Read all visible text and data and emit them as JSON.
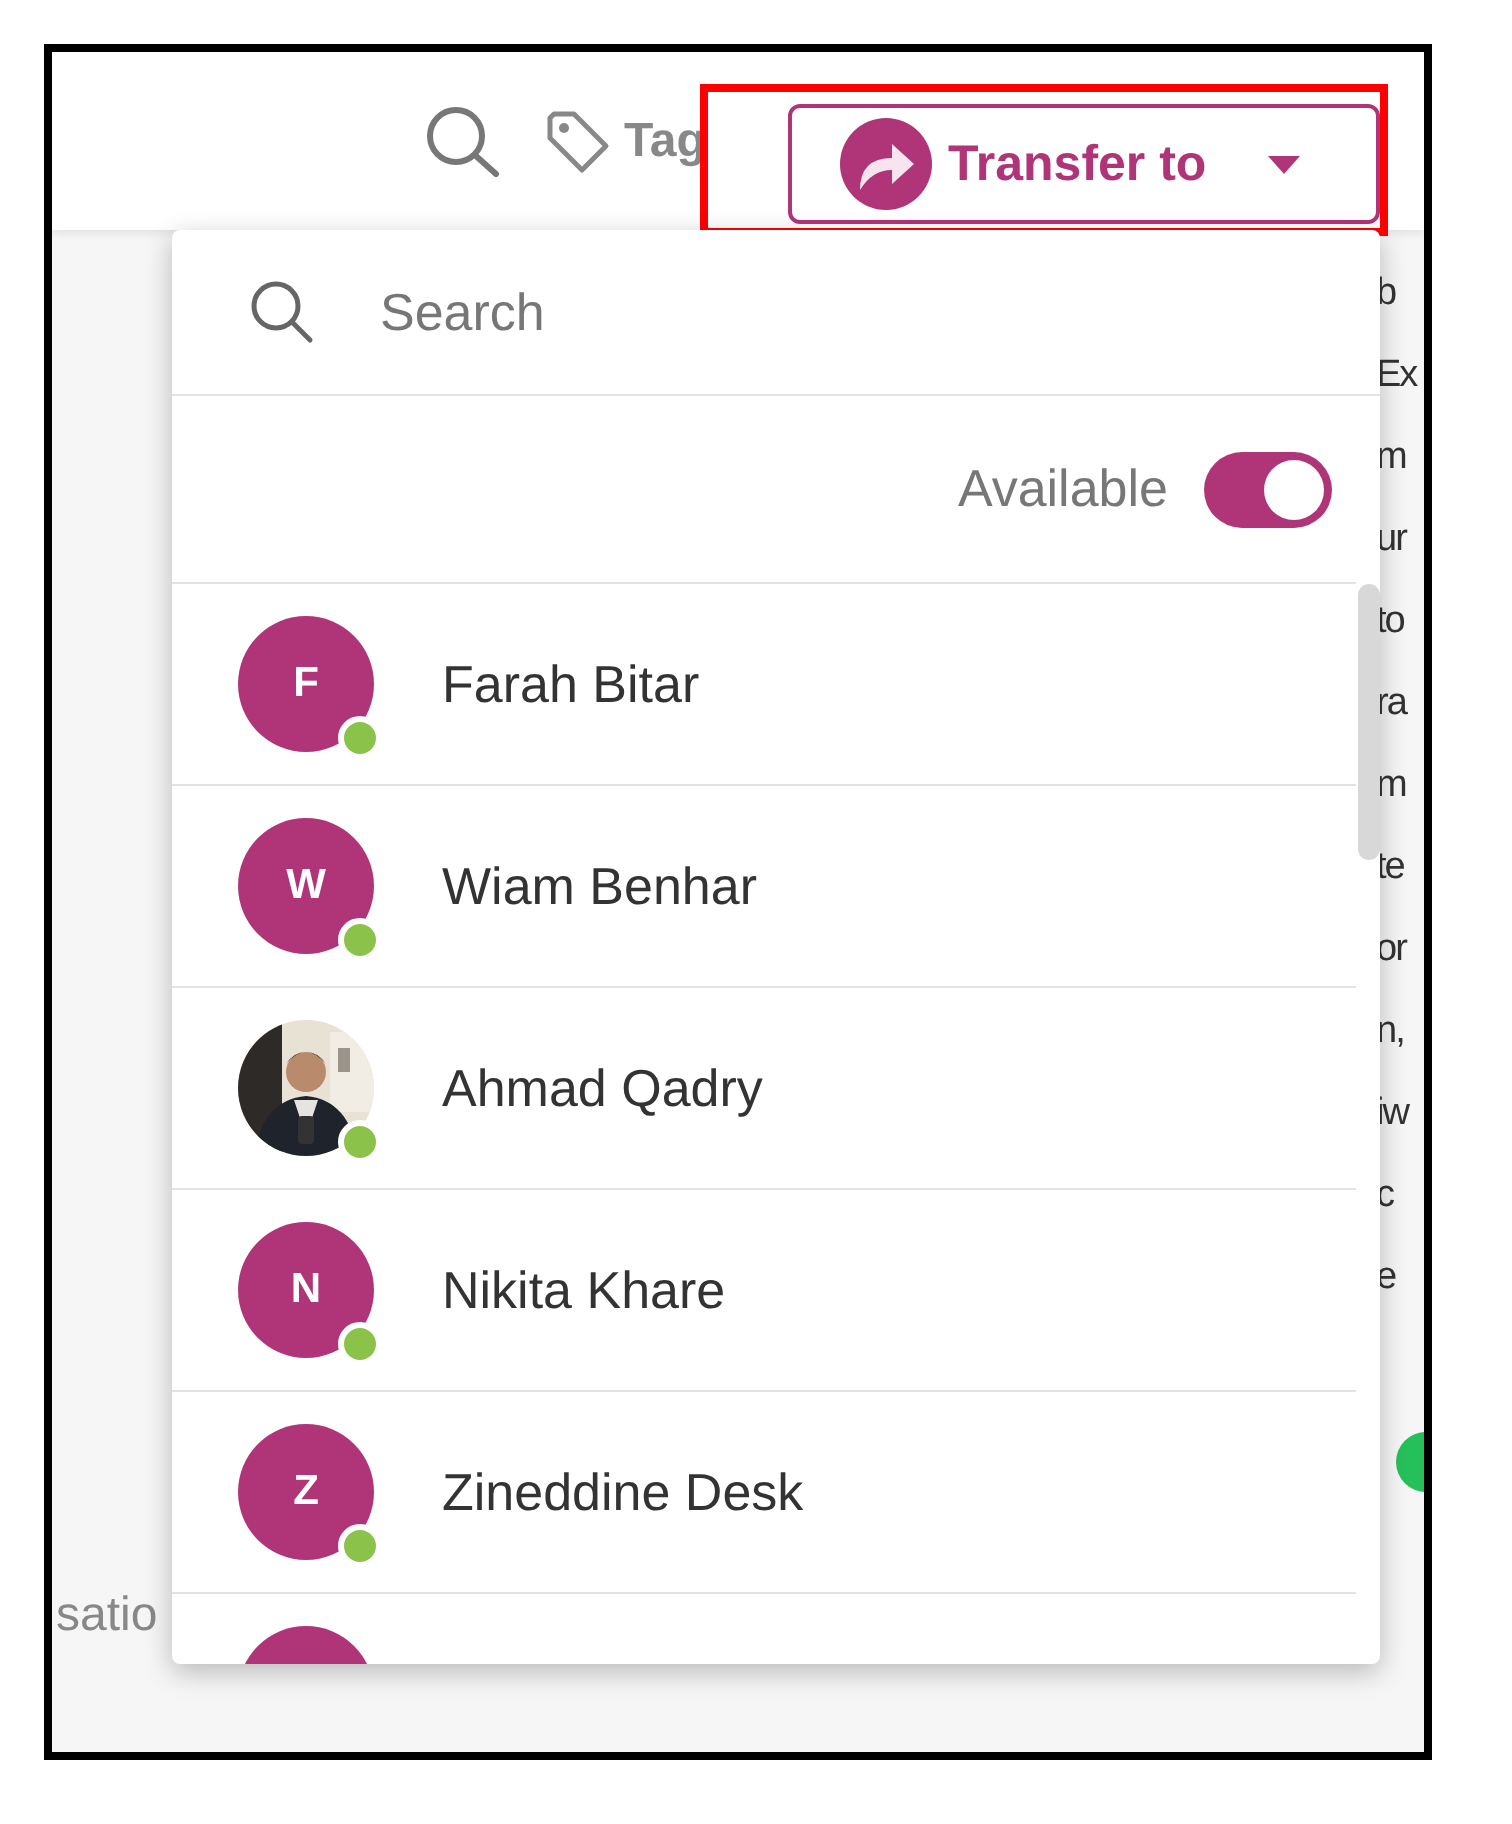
{
  "toolbar": {
    "tag_label": "Tag",
    "transfer_button": {
      "label": "Transfer to",
      "highlighted": true
    }
  },
  "background_text": [
    "b",
    "Ex",
    "m",
    "ur",
    "to",
    "ra",
    "m",
    "te",
    "or",
    "n,",
    "iw",
    "c",
    "e"
  ],
  "side_label": "satio",
  "transfer_menu": {
    "search": {
      "placeholder": "Search"
    },
    "available": {
      "label": "Available",
      "on": true
    },
    "agents": [
      {
        "kind": "letter",
        "initial": "F",
        "name": "Farah Bitar",
        "online": true
      },
      {
        "kind": "letter",
        "initial": "W",
        "name": "Wiam Benhar",
        "online": true
      },
      {
        "kind": "picture",
        "name": "Ahmad Qadry",
        "online": true
      },
      {
        "kind": "letter",
        "initial": "N",
        "name": "Nikita Khare",
        "online": true
      },
      {
        "kind": "letter",
        "initial": "Z",
        "name": "Zineddine Desk",
        "online": true
      },
      {
        "kind": "cut"
      }
    ]
  }
}
